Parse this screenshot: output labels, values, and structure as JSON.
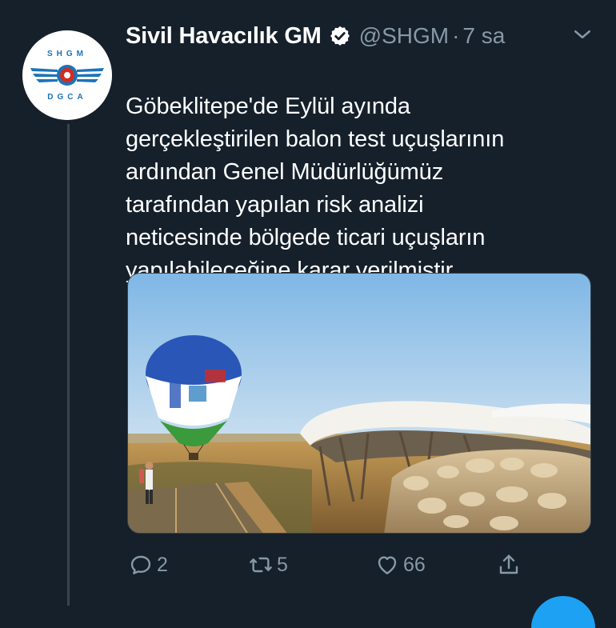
{
  "tweet": {
    "author_name": "Sivil Havacılık GM",
    "handle": "@SHGM",
    "separator": "·",
    "time": "7 sa",
    "text_lines": [
      "Göbeklitepe'de Eylül ayında",
      "gerçekleştirilen balon test uçuşlarının",
      "ardından Genel Müdürlüğümüz",
      "tarafından yapılan risk analizi",
      "neticesinde bölgede ticari uçuşların",
      "yapılabileceğine karar verilmiştir."
    ],
    "avatar": {
      "top_text": "SHGM",
      "bottom_text": "DGCA"
    }
  },
  "actions": {
    "replies": "2",
    "retweets": "5",
    "likes": "66"
  },
  "icons": {
    "verified": "verified-badge-icon",
    "caret": "chevron-down-icon",
    "reply": "reply-icon",
    "retweet": "retweet-icon",
    "like": "heart-icon",
    "share": "share-icon"
  },
  "colors": {
    "background": "#15202b",
    "secondary_text": "#8899a6",
    "accent": "#1da1f2",
    "avatar_blue": "#1b73b9",
    "avatar_red": "#d52b1e"
  }
}
